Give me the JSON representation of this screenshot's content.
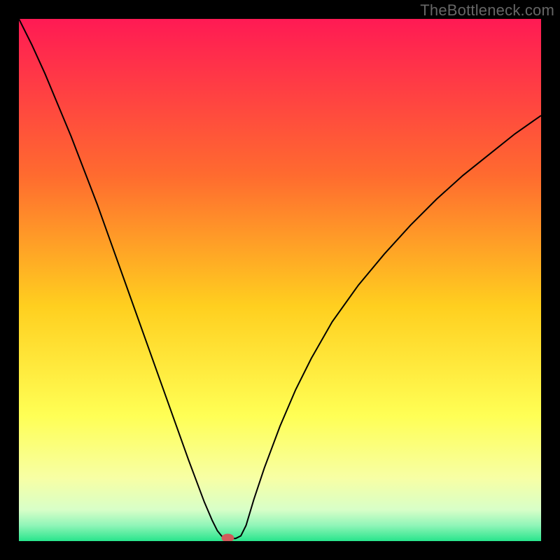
{
  "watermark": "TheBottleneck.com",
  "chart_data": {
    "type": "line",
    "title": "",
    "xlabel": "",
    "ylabel": "",
    "xlim": [
      0,
      100
    ],
    "ylim": [
      0,
      100
    ],
    "background_gradient": {
      "stops": [
        {
          "offset": 0.0,
          "color": "#ff1a54"
        },
        {
          "offset": 0.3,
          "color": "#ff6b2f"
        },
        {
          "offset": 0.55,
          "color": "#ffcf1f"
        },
        {
          "offset": 0.76,
          "color": "#ffff55"
        },
        {
          "offset": 0.88,
          "color": "#f7ffa5"
        },
        {
          "offset": 0.94,
          "color": "#d8ffc8"
        },
        {
          "offset": 0.97,
          "color": "#90f5b8"
        },
        {
          "offset": 1.0,
          "color": "#28e58c"
        }
      ]
    },
    "series": [
      {
        "name": "bottleneck-curve",
        "x": [
          0.0,
          2.5,
          5.0,
          7.5,
          10.0,
          12.5,
          15.0,
          17.5,
          20.0,
          22.5,
          25.0,
          27.5,
          30.0,
          32.5,
          34.0,
          35.5,
          37.0,
          38.0,
          38.8,
          39.5,
          40.5,
          41.5,
          42.5,
          43.5,
          45.0,
          47.0,
          50.0,
          53.0,
          56.0,
          60.0,
          65.0,
          70.0,
          75.0,
          80.0,
          85.0,
          90.0,
          95.0,
          100.0
        ],
        "y": [
          100.0,
          95.0,
          89.5,
          83.5,
          77.5,
          71.0,
          64.5,
          57.5,
          50.5,
          43.5,
          36.5,
          29.5,
          22.5,
          15.5,
          11.5,
          7.5,
          4.0,
          2.0,
          1.0,
          0.5,
          0.5,
          0.5,
          1.0,
          3.0,
          8.0,
          14.0,
          22.0,
          29.0,
          35.0,
          42.0,
          49.0,
          55.0,
          60.5,
          65.5,
          70.0,
          74.0,
          78.0,
          81.5
        ]
      }
    ],
    "marker": {
      "name": "optimum-point",
      "x": 40.0,
      "y": 0.6,
      "rx": 1.2,
      "ry": 0.8,
      "color": "#d15a5a"
    }
  }
}
